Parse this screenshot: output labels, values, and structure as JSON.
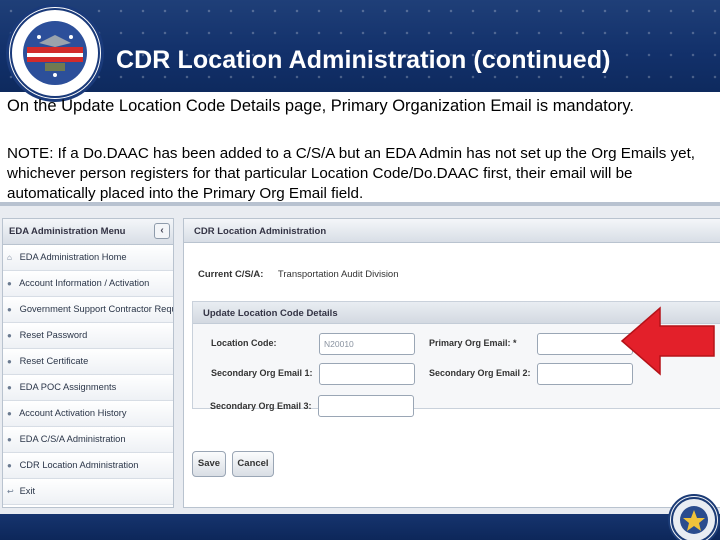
{
  "slide": {
    "title": "CDR Location Administration (continued)",
    "intro": "On the Update Location Code Details page, Primary Organization Email is mandatory.",
    "note": "NOTE: If a Do.DAAC has been added to a C/S/A but an EDA Admin has not set up the Org Emails yet, whichever person registers for that particular Location Code/Do.DAAC first, their email will be automatically placed into the Primary Org Email field."
  },
  "seal": {
    "top_text": "Director",
    "bottom_text": "Business Transformation"
  },
  "menu": {
    "header": "EDA Administration Menu",
    "collapse_icon": "chevron-left-icon",
    "items": [
      {
        "label": "EDA Administration Home",
        "icon": "home-icon"
      },
      {
        "label": "Account Information / Activation",
        "icon": "user-icon"
      },
      {
        "label": "Government Support Contractor Request",
        "icon": "user-icon"
      },
      {
        "label": "Reset Password",
        "icon": "user-icon"
      },
      {
        "label": "Reset Certificate",
        "icon": "user-icon"
      },
      {
        "label": "EDA POC Assignments",
        "icon": "user-icon"
      },
      {
        "label": "Account Activation History",
        "icon": "user-icon"
      },
      {
        "label": "EDA C/S/A Administration",
        "icon": "user-icon"
      },
      {
        "label": "CDR Location Administration",
        "icon": "user-icon"
      },
      {
        "label": "Exit",
        "icon": "exit-icon"
      }
    ]
  },
  "panel": {
    "header": "CDR Location Administration",
    "csa_label": "Current C/S/A:",
    "csa_value": "Transportation Audit Division",
    "sub_header": "Update Location Code Details",
    "location_code_label": "Location Code:",
    "location_code_value": "N20010",
    "primary_email_label": "Primary Org Email: *",
    "primary_email_value": "",
    "secondary1_label": "Secondary Org Email 1:",
    "secondary1_value": "",
    "secondary2_label": "Secondary Org Email 2:",
    "secondary2_value": "",
    "secondary3_label": "Secondary Org Email 3:",
    "secondary3_value": "",
    "save_label": "Save",
    "cancel_label": "Cancel"
  },
  "colors": {
    "header_blue": "#12306a",
    "arrow_red": "#e3202a",
    "panel_border": "#b9c3cf"
  }
}
